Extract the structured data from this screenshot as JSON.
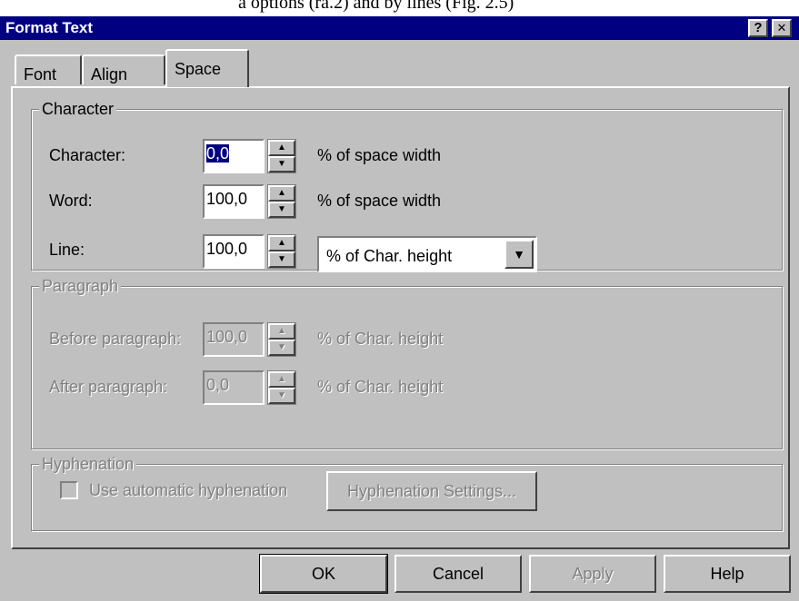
{
  "top_text": "a options (ra.2) and by lines (Fig. 2.5)",
  "window": {
    "title": "Format Text",
    "help_glyph": "?",
    "close_glyph": "✕"
  },
  "tabs": [
    {
      "label": "Font"
    },
    {
      "label": "Align"
    },
    {
      "label": "Space"
    }
  ],
  "character_group": {
    "legend": "Character",
    "rows": [
      {
        "label": "Character:",
        "value": "0,0",
        "unit": "% of space width"
      },
      {
        "label": "Word:",
        "value": "100,0",
        "unit": "% of space width"
      },
      {
        "label": "Line:",
        "value": "100,0",
        "unit_select": "% of Char. height"
      }
    ]
  },
  "paragraph_group": {
    "legend": "Paragraph",
    "rows": [
      {
        "label": "Before paragraph:",
        "value": "100,0",
        "unit": "% of Char. height"
      },
      {
        "label": "After paragraph:",
        "value": "0,0",
        "unit": "% of Char. height"
      }
    ]
  },
  "hyphenation_group": {
    "legend": "Hyphenation",
    "checkbox_label": "Use automatic hyphenation",
    "checkbox_checked": false,
    "settings_button": "Hyphenation Settings..."
  },
  "buttons": {
    "ok": "OK",
    "cancel": "Cancel",
    "apply": "Apply",
    "help": "Help"
  },
  "colors": {
    "titlebar": "#000080",
    "face": "#c0c0c0",
    "disabled_text": "#808080"
  }
}
